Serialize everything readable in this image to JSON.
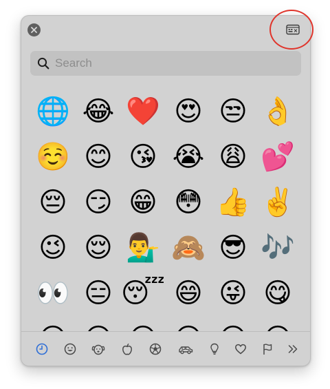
{
  "search": {
    "placeholder": "Search",
    "value": ""
  },
  "emoji_rows": [
    [
      "🌐",
      "😂",
      "❤️",
      "😍",
      "😒",
      "👌"
    ],
    [
      "☺️",
      "😊",
      "😘",
      "😭",
      "😩",
      "💕"
    ],
    [
      "😔",
      "😏",
      "😁",
      "😳",
      "👍",
      "✌️"
    ],
    [
      "😉",
      "😌",
      "💁‍♂️",
      "🙈",
      "😎",
      "🎶"
    ],
    [
      "👀",
      "😑",
      "😴",
      "😄",
      "😜",
      "😋"
    ],
    [
      "😀",
      "😀",
      "😀",
      "😀",
      "😀",
      "😀"
    ]
  ],
  "category_tabs": [
    {
      "name": "tab-frequently-used",
      "icon": "clock-icon",
      "selected": true
    },
    {
      "name": "tab-smileys-people",
      "icon": "smiley-icon",
      "selected": false
    },
    {
      "name": "tab-animals-nature",
      "icon": "dog-icon",
      "selected": false
    },
    {
      "name": "tab-food-drink",
      "icon": "apple-icon",
      "selected": false
    },
    {
      "name": "tab-activity",
      "icon": "soccer-ball-icon",
      "selected": false
    },
    {
      "name": "tab-travel-places",
      "icon": "car-icon",
      "selected": false
    },
    {
      "name": "tab-objects",
      "icon": "lightbulb-icon",
      "selected": false
    },
    {
      "name": "tab-symbols",
      "icon": "heart-icon",
      "selected": false
    },
    {
      "name": "tab-flags",
      "icon": "flag-icon",
      "selected": false
    },
    {
      "name": "tab-more",
      "icon": "chevrons-right-icon",
      "selected": false
    }
  ],
  "colors": {
    "panel": "#d2d2d2",
    "search_field": "#c2c2c2",
    "selected_tab": "#2f6fd6",
    "highlight_ring": "#e0342b"
  }
}
